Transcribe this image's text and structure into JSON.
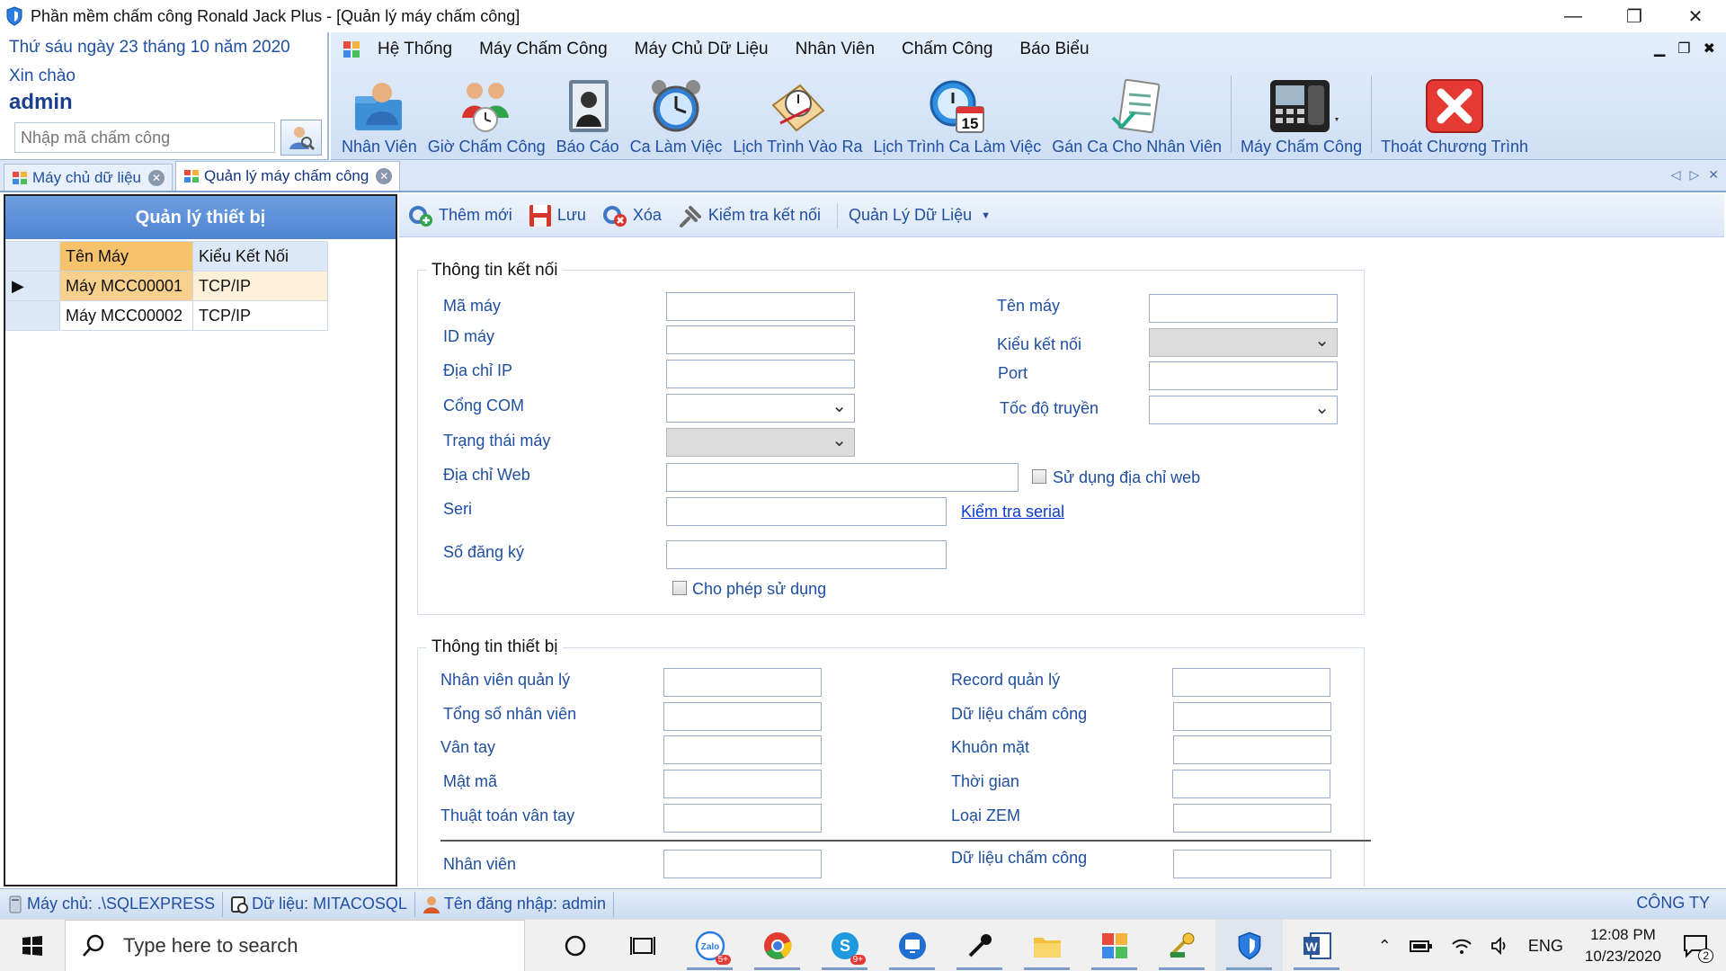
{
  "window": {
    "title": "Phần mềm chấm công Ronald Jack Plus - [Quản lý máy chấm công]",
    "minimize": "—",
    "restore": "❐",
    "close": "✕"
  },
  "info": {
    "date": "Thứ sáu ngày 23 tháng 10 năm 2020",
    "greeting": "Xin chào",
    "user": "admin",
    "search_placeholder": "Nhập mã chấm công"
  },
  "menu": {
    "items": [
      "Hệ Thống",
      "Máy Chấm Công",
      "Máy Chủ Dữ Liệu",
      "Nhân Viên",
      "Chấm Công",
      "Báo Biểu"
    ],
    "mdi_min": "▁",
    "mdi_restore": "❐",
    "mdi_close": "✖"
  },
  "ribbon": {
    "tools": [
      {
        "label": "Nhân Viên",
        "icon": "employee-icon"
      },
      {
        "label": "Giờ Chấm Công",
        "icon": "attendance-time-icon"
      },
      {
        "label": "Báo Cáo",
        "icon": "report-icon"
      },
      {
        "label": "Ca Làm Việc",
        "icon": "alarm-clock-icon"
      },
      {
        "label": "Lịch Trình Vào Ra",
        "icon": "schedule-icon"
      },
      {
        "label": "Lịch Trình Ca Làm Việc",
        "icon": "calendar-clock-icon"
      },
      {
        "label": "Gán Ca Cho Nhân Viên",
        "icon": "assign-shift-icon"
      },
      {
        "label": "Máy Chấm Công",
        "icon": "attendance-machine-icon"
      },
      {
        "label": "Thoát Chương Trình",
        "icon": "exit-icon"
      }
    ],
    "calendar_day": "15"
  },
  "tabs": [
    {
      "label": "Máy chủ dữ liệu",
      "active": false
    },
    {
      "label": "Quản lý máy chấm công",
      "active": true
    }
  ],
  "device_panel": {
    "title": "Quản lý thiết bị",
    "columns": [
      "Tên Máy",
      "Kiểu Kết Nối"
    ],
    "rows": [
      {
        "name": "Máy MCC00001",
        "connection": "TCP/IP",
        "current": true
      },
      {
        "name": "Máy MCC00002",
        "connection": "TCP/IP",
        "current": false
      }
    ]
  },
  "toolbar": {
    "add": "Thêm mới",
    "save": "Lưu",
    "delete": "Xóa",
    "check": "Kiểm tra kết nối",
    "data_manage": "Quản Lý Dữ Liệu"
  },
  "connection": {
    "title": "Thông tin kết nối",
    "ma_may": "Mã máy",
    "id_may": "ID máy",
    "dia_chi_ip": "Địa chỉ IP",
    "cong_com": "Cổng COM",
    "trang_thai": "Trạng thái máy",
    "dia_chi_web": "Địa chỉ Web",
    "seri": "Seri",
    "so_dang_ky": "Số đăng ký",
    "ten_may": "Tên máy",
    "kieu_ket_noi": "Kiểu kết nối",
    "port": "Port",
    "toc_do": "Tốc độ truyền",
    "use_web": "Sử dụng địa chỉ web",
    "check_serial": "Kiểm tra serial",
    "allow_use": "Cho phép sử dụng"
  },
  "device": {
    "title": "Thông tin thiết bị",
    "left": [
      "Nhân viên quản lý",
      "Tổng số nhân viên",
      "Vân tay",
      "Mật mã",
      "Thuật toán vân tay",
      "Nhân viên"
    ],
    "right": [
      "Record quản lý",
      "Dữ liệu chấm công",
      "Khuôn mặt",
      "Thời gian",
      "Loại ZEM",
      "Dữ liệu chấm công"
    ]
  },
  "status": {
    "server": "Máy chủ: .\\SQLEXPRESS",
    "database": "Dữ liệu: MITACOSQL",
    "login": "Tên đăng nhập: admin",
    "company": "CÔNG TY"
  },
  "taskbar": {
    "search_placeholder": "Type here to search",
    "lang": "ENG",
    "time": "12:08 PM",
    "date": "10/23/2020",
    "zalo_badge": "5+",
    "skype_badge": "9+",
    "notif_count": "2"
  },
  "colors": {
    "accent": "#4f84d1",
    "link": "#0b3bd6",
    "label": "#1f4fa0"
  }
}
